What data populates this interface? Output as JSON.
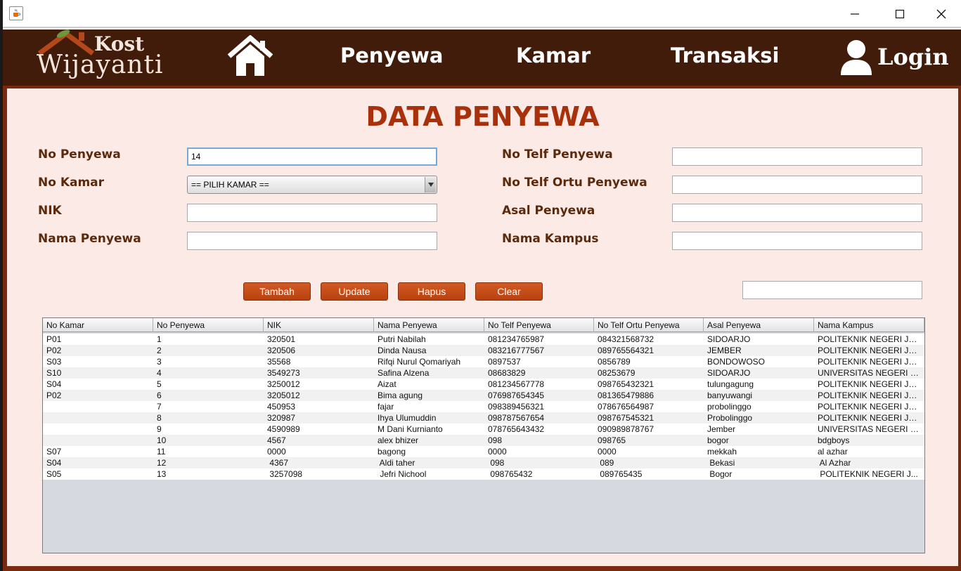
{
  "window": {
    "app_icon": "java-cup-icon",
    "controls": [
      "minimize-icon",
      "maximize-icon",
      "close-icon"
    ]
  },
  "header": {
    "logo": {
      "line1": "Kost",
      "line2": "Wijayanti"
    },
    "nav": {
      "home_icon": "house-icon",
      "penyewa": "Penyewa",
      "kamar": "Kamar",
      "transaksi": "Transaksi",
      "login": "Login",
      "login_icon": "user-icon"
    }
  },
  "page": {
    "title": "DATA PENYEWA"
  },
  "form": {
    "left": {
      "no_penyewa": {
        "label": "No Penyewa",
        "value": "14"
      },
      "no_kamar": {
        "label": "No Kamar",
        "selected": "== PILIH KAMAR =="
      },
      "nik": {
        "label": "NIK",
        "value": ""
      },
      "nama_penyewa": {
        "label": "Nama Penyewa",
        "value": ""
      }
    },
    "right": {
      "no_telf_penyewa": {
        "label": "No Telf  Penyewa",
        "value": ""
      },
      "no_telf_ortu": {
        "label": "No Telf Ortu Penyewa",
        "value": ""
      },
      "asal_penyewa": {
        "label": "Asal Penyewa",
        "value": ""
      },
      "nama_kampus": {
        "label": "Nama Kampus",
        "value": ""
      }
    },
    "search": {
      "value": ""
    }
  },
  "buttons": {
    "tambah": "Tambah",
    "update": "Update",
    "hapus": "Hapus",
    "clear": "Clear"
  },
  "colors": {
    "header_bg": "#411c0a",
    "content_bg": "#fbeae5",
    "title": "#a8310c",
    "label": "#5a2a0e",
    "button": "#c44e1a"
  },
  "table": {
    "columns": [
      "No Kamar",
      "No Penyewa",
      "NIK",
      "Nama Penyewa",
      "No Telf Penyewa",
      "No Telf Ortu Penyewa",
      "Asal Penyewa",
      "Nama Kampus"
    ],
    "rows": [
      [
        "P01",
        "1",
        "320501",
        "Putri Nabilah",
        "081234765987",
        "084321568732",
        "SIDOARJO",
        "POLITEKNIK NEGERI JE..."
      ],
      [
        "P02",
        "2",
        "320506",
        "Dinda Nausa",
        "083216777567",
        "089765564321",
        "JEMBER",
        "POLITEKNIK NEGERI JE..."
      ],
      [
        "S03",
        "3",
        "35568",
        "Rifqi Nurul Qomariyah",
        "0897537",
        "0856789",
        "BONDOWOSO",
        "POLITEKNIK NEGERI JE..."
      ],
      [
        "S10",
        "4",
        "3549273",
        "Safina Alzena",
        "08683829",
        "08253679",
        "SIDOARJO",
        "UNIVERSITAS NEGERI J..."
      ],
      [
        "S04",
        "5",
        "3250012",
        "Aizat",
        "081234567778",
        "098765432321",
        "tulungagung",
        "POLITEKNIK NEGERI JE..."
      ],
      [
        "P02",
        "6",
        "3205012",
        "Bima agung",
        "076987654345",
        "081365479886",
        "banyuwangi",
        "POLITEKNIK NEGERI JE..."
      ],
      [
        "",
        "7",
        "450953",
        "fajar",
        "098389456321",
        "078676564987",
        "probolinggo",
        "POLITEKNIK NEGERI JE..."
      ],
      [
        "",
        "8",
        "320987",
        "Ihya Ulumuddin",
        "098787567654",
        "098767545321",
        "Probolinggo",
        "POLITEKNIK NEGERI JE..."
      ],
      [
        "",
        "9",
        "4590989",
        "M Dani Kurnianto",
        "078765643432",
        "090989878767",
        "Jember",
        "UNIVERSITAS NEGERI J..."
      ],
      [
        "",
        "10",
        "4567",
        "alex bhizer",
        "098",
        "098765",
        "bogor",
        "bdgboys"
      ],
      [
        "S07",
        "11",
        "0000",
        "bagong",
        "0000",
        "0000",
        "mekkah",
        "al azhar"
      ],
      [
        "S04",
        "12",
        " 4367",
        " Aldi taher",
        " 098",
        " 089",
        " Bekasi",
        " Al Azhar"
      ],
      [
        "S05",
        "13",
        " 3257098",
        " Jefri Nichool",
        " 098765432",
        " 089765435",
        " Bogor",
        " POLITEKNIK NEGERI J..."
      ]
    ]
  }
}
